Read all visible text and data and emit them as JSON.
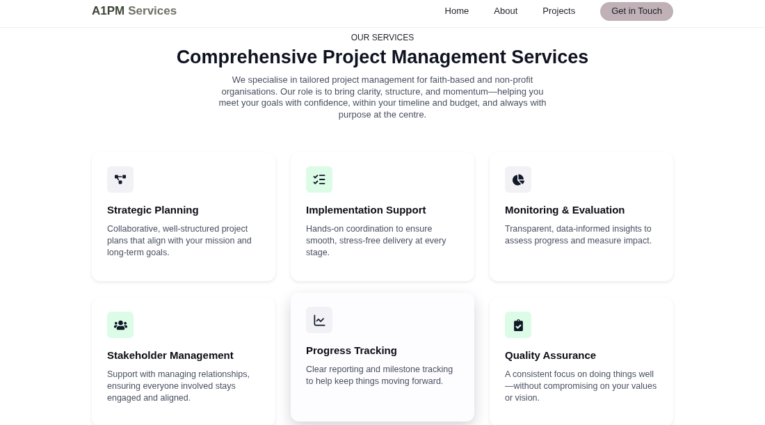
{
  "header": {
    "logo": {
      "primary": "A1PM",
      "secondary": "Services"
    },
    "nav": [
      "Home",
      "About",
      "Projects"
    ],
    "cta": "Get in Touch"
  },
  "section": {
    "eyebrow": "OUR SERVICES",
    "title": "Comprehensive Project Management Services",
    "intro": "We specialise in tailored project management for faith-based and non-profit organisations. Our role is to bring clarity, structure, and momentum—helping you meet your goals with confidence, within your timeline and budget, and always with purpose at the centre."
  },
  "cards": [
    {
      "title": "Strategic Planning",
      "description": "Collaborative, well-structured project plans that align with your mission and long-term goals.",
      "color": "#f2f2f6",
      "raised": false
    },
    {
      "title": "Implementation Support",
      "description": "Hands-on coordination to ensure smooth, stress-free delivery at every stage.",
      "color": "#dcfce7",
      "raised": false
    },
    {
      "title": "Monitoring & Evaluation",
      "description": "Transparent, data-informed insights to assess progress and measure impact.",
      "color": "#f2f2f6",
      "raised": false
    },
    {
      "title": "Stakeholder Management",
      "description": "Support with managing relationships, ensuring everyone involved stays engaged and aligned.",
      "color": "#dcfce7",
      "raised": false
    },
    {
      "title": "Progress Tracking",
      "description": "Clear reporting and milestone tracking to help keep things moving forward.",
      "color": "#f2f2f6",
      "raised": true
    },
    {
      "title": "Quality Assurance",
      "description": "A consistent focus on doing things well—without compromising on your values or vision.",
      "color": "#dcfce7",
      "raised": false
    }
  ]
}
